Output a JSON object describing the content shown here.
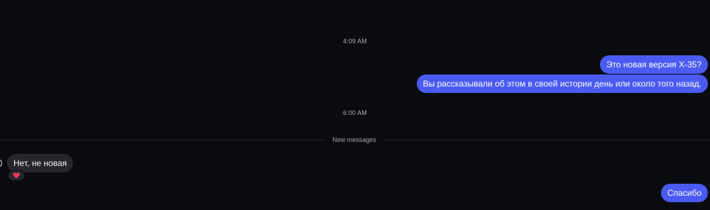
{
  "timestamps": {
    "first": "4:09 AM",
    "second": "6:00 AM"
  },
  "messages": {
    "out_1": "Это новая версия Х-35?",
    "out_2": "Вы рассказывали об этом в своей истории день или около того назад.",
    "in_1": "Нет, не новая",
    "out_3": "Спасибо"
  },
  "divider": {
    "label": "New messages"
  },
  "reaction": {
    "icon": "heart-icon",
    "color": "#e8395e"
  },
  "colors": {
    "outgoing_bubble": "#4a5bf2",
    "incoming_bubble": "#26272b",
    "background": "#0b0c10"
  }
}
